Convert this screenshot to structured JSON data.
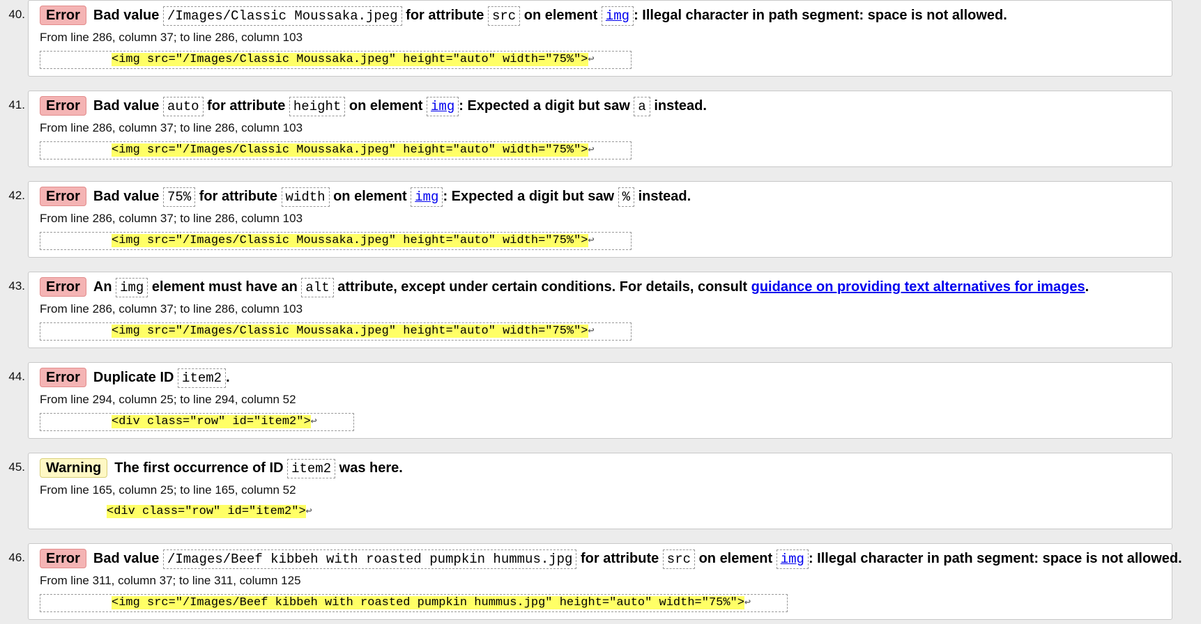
{
  "messages": [
    {
      "number": "40.",
      "badge": "Error",
      "parts": [
        {
          "t": "text",
          "v": "Bad value "
        },
        {
          "t": "code",
          "v": "/Images/Classic Moussaka.jpeg"
        },
        {
          "t": "text",
          "v": " for attribute "
        },
        {
          "t": "code",
          "v": "src"
        },
        {
          "t": "text",
          "v": " on element "
        },
        {
          "t": "codelink",
          "v": "img"
        },
        {
          "t": "text",
          "v": ": Illegal character in path segment: space is not allowed."
        }
      ],
      "location": "From line 286, column 37; to line 286, column 103",
      "extract": "<img src=\"/Images/Classic Moussaka.jpeg\" height=\"auto\" width=\"75%\">",
      "return_char": "↩"
    },
    {
      "number": "41.",
      "badge": "Error",
      "parts": [
        {
          "t": "text",
          "v": "Bad value "
        },
        {
          "t": "code",
          "v": "auto"
        },
        {
          "t": "text",
          "v": " for attribute "
        },
        {
          "t": "code",
          "v": "height"
        },
        {
          "t": "text",
          "v": " on element "
        },
        {
          "t": "codelink",
          "v": "img"
        },
        {
          "t": "text",
          "v": ": Expected a digit but saw "
        },
        {
          "t": "code",
          "v": "a"
        },
        {
          "t": "text",
          "v": " instead."
        }
      ],
      "location": "From line 286, column 37; to line 286, column 103",
      "extract": "<img src=\"/Images/Classic Moussaka.jpeg\" height=\"auto\" width=\"75%\">",
      "return_char": "↩"
    },
    {
      "number": "42.",
      "badge": "Error",
      "parts": [
        {
          "t": "text",
          "v": "Bad value "
        },
        {
          "t": "code",
          "v": "75%"
        },
        {
          "t": "text",
          "v": " for attribute "
        },
        {
          "t": "code",
          "v": "width"
        },
        {
          "t": "text",
          "v": " on element "
        },
        {
          "t": "codelink",
          "v": "img"
        },
        {
          "t": "text",
          "v": ": Expected a digit but saw "
        },
        {
          "t": "code",
          "v": "%"
        },
        {
          "t": "text",
          "v": " instead."
        }
      ],
      "location": "From line 286, column 37; to line 286, column 103",
      "extract": "<img src=\"/Images/Classic Moussaka.jpeg\" height=\"auto\" width=\"75%\">",
      "return_char": "↩"
    },
    {
      "number": "43.",
      "badge": "Error",
      "parts": [
        {
          "t": "text",
          "v": "An "
        },
        {
          "t": "code",
          "v": "img"
        },
        {
          "t": "text",
          "v": " element must have an "
        },
        {
          "t": "code",
          "v": "alt"
        },
        {
          "t": "text",
          "v": " attribute, except under certain conditions. For details, consult "
        },
        {
          "t": "link",
          "v": "guidance on providing text alternatives for images"
        },
        {
          "t": "text",
          "v": "."
        }
      ],
      "location": "From line 286, column 37; to line 286, column 103",
      "extract": "<img src=\"/Images/Classic Moussaka.jpeg\" height=\"auto\" width=\"75%\">",
      "return_char": "↩"
    },
    {
      "number": "44.",
      "badge": "Error",
      "parts": [
        {
          "t": "text",
          "v": "Duplicate ID "
        },
        {
          "t": "code",
          "v": "item2"
        },
        {
          "t": "text",
          "v": "."
        }
      ],
      "location": "From line 294, column 25; to line 294, column 52",
      "extract": "<div class=\"row\" id=\"item2\">",
      "return_char": "↩"
    },
    {
      "number": "45.",
      "badge": "Warning",
      "parts": [
        {
          "t": "text",
          "v": "The first occurrence of ID "
        },
        {
          "t": "code",
          "v": "item2"
        },
        {
          "t": "text",
          "v": " was here."
        }
      ],
      "location": "From line 165, column 25; to line 165, column 52",
      "extract": "<div class=\"row\" id=\"item2\">",
      "return_char": "↩"
    },
    {
      "number": "46.",
      "badge": "Error",
      "parts": [
        {
          "t": "text",
          "v": "Bad value "
        },
        {
          "t": "code",
          "v": "/Images/Beef kibbeh with roasted pumpkin hummus.jpg"
        },
        {
          "t": "text",
          "v": " for attribute "
        },
        {
          "t": "code",
          "v": "src"
        },
        {
          "t": "text",
          "v": " on element "
        },
        {
          "t": "codelink",
          "v": "img"
        },
        {
          "t": "text",
          "v": ": Illegal character in path segment: space is not allowed."
        }
      ],
      "location": "From line 311, column 37; to line 311, column 125",
      "extract": "<img src=\"/Images/Beef kibbeh with roasted pumpkin hummus.jpg\" height=\"auto\" width=\"75%\">",
      "return_char": "↩"
    }
  ]
}
